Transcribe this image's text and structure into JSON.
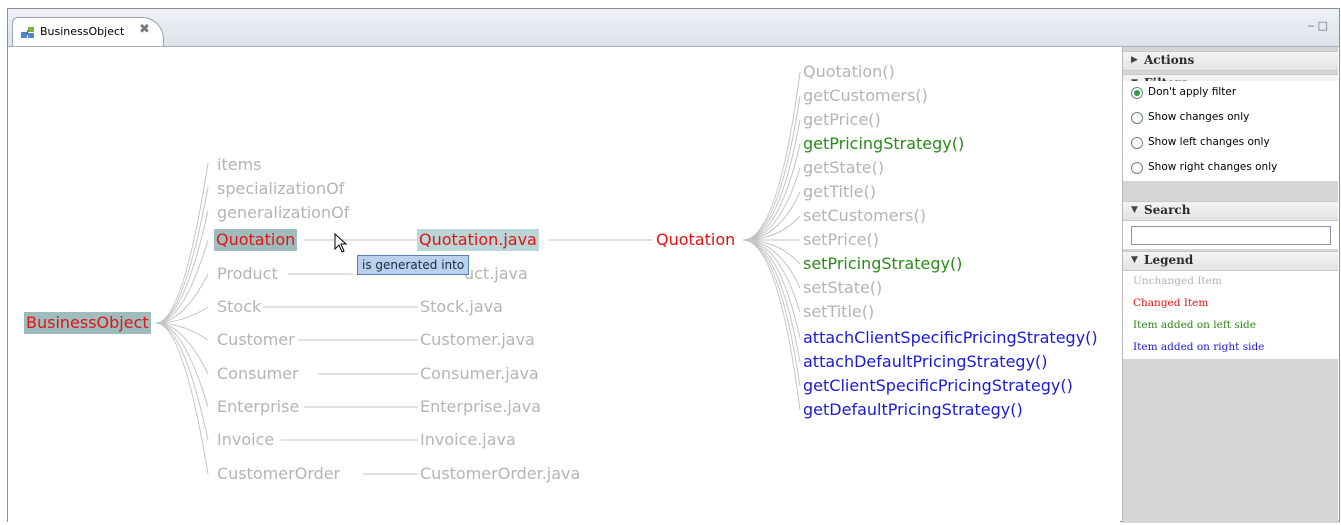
{
  "tab": {
    "title": "BusinessObject",
    "close_glyph": "✖",
    "icon": "class-diagram-icon"
  },
  "window_controls": {
    "minimize": "‒",
    "maximize": "□"
  },
  "graph": {
    "root": "BusinessObject",
    "level1": [
      "items",
      "specializationOf",
      "generalizationOf",
      "Quotation",
      "Product",
      "Stock",
      "Customer",
      "Consumer",
      "Enterprise",
      "Invoice",
      "CustomerOrder"
    ],
    "level2": [
      "Quotation.java",
      "uct.java",
      "Stock.java",
      "Customer.java",
      "Consumer.java",
      "Enterprise.java",
      "Invoice.java",
      "CustomerOrder.java"
    ],
    "class_node": "Quotation",
    "methods": [
      {
        "name": "Quotation()",
        "status": "unchanged"
      },
      {
        "name": "getCustomers()",
        "status": "unchanged"
      },
      {
        "name": "getPrice()",
        "status": "unchanged"
      },
      {
        "name": "getPricingStrategy()",
        "status": "added-left"
      },
      {
        "name": "getState()",
        "status": "unchanged"
      },
      {
        "name": "getTitle()",
        "status": "unchanged"
      },
      {
        "name": "setCustomers()",
        "status": "unchanged"
      },
      {
        "name": "setPrice()",
        "status": "unchanged"
      },
      {
        "name": "setPricingStrategy()",
        "status": "added-left"
      },
      {
        "name": "setState()",
        "status": "unchanged"
      },
      {
        "name": "setTitle()",
        "status": "unchanged"
      },
      {
        "name": "attachClientSpecificPricingStrategy()",
        "status": "added-right"
      },
      {
        "name": "attachDefaultPricingStrategy()",
        "status": "added-right"
      },
      {
        "name": "getClientSpecificPricingStrategy()",
        "status": "added-right"
      },
      {
        "name": "getDefaultPricingStrategy()",
        "status": "added-right"
      }
    ],
    "tooltip": "is generated into"
  },
  "sidebar": {
    "actions_title": "Actions",
    "filters_title": "Filters",
    "filters": [
      {
        "label": "Don't apply filter",
        "selected": true
      },
      {
        "label": "Show changes only",
        "selected": false
      },
      {
        "label": "Show left changes only",
        "selected": false
      },
      {
        "label": "Show right changes only",
        "selected": false
      }
    ],
    "search_title": "Search",
    "search_value": "",
    "legend_title": "Legend",
    "legend": [
      {
        "label": "Unchanged Item",
        "color": "#b4b4b4"
      },
      {
        "label": "Changed Item",
        "color": "#e31212"
      },
      {
        "label": "Item added on left side",
        "color": "#2b8a1a"
      },
      {
        "label": "Item added on right side",
        "color": "#1a1ad8"
      }
    ]
  },
  "colors": {
    "unchanged": "#b4b4b4",
    "changed": "#e31212",
    "added_left": "#2b8a1a",
    "added_right": "#1a1ad8"
  }
}
